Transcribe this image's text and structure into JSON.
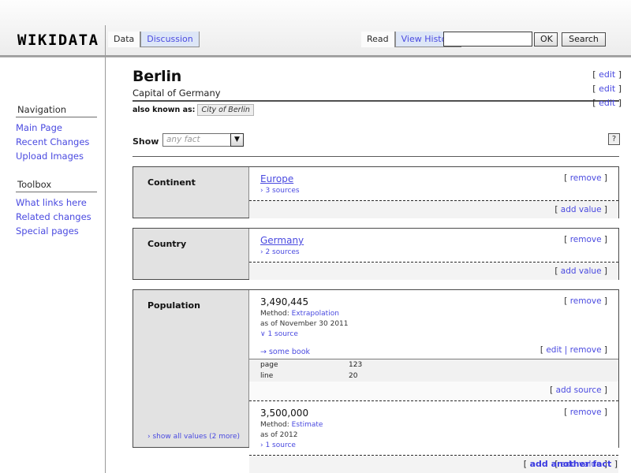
{
  "header": {
    "logo": "WIKIDATA",
    "left_tabs": [
      {
        "label": "Data",
        "active": true
      },
      {
        "label": "Discussion",
        "active": false
      }
    ],
    "right_tabs": [
      {
        "label": "Read",
        "active": true
      },
      {
        "label": "View History",
        "active": false
      }
    ],
    "search": {
      "value": "",
      "placeholder": ""
    },
    "ok_label": "OK",
    "search_label": "Search"
  },
  "sidebar": {
    "navigation_heading": "Navigation",
    "navigation_items": [
      "Main Page",
      "Recent Changes",
      "Upload Images"
    ],
    "toolbox_heading": "Toolbox",
    "toolbox_items": [
      "What links here",
      "Related changes",
      "Special pages"
    ]
  },
  "page": {
    "title": "Berlin",
    "subtitle": "Capital of Germany",
    "aka_label": "also known as:",
    "aka_value": "City of Berlin",
    "edit_label": "[ edit ]",
    "edit_text": "edit"
  },
  "filter": {
    "show_label": "Show",
    "selected": "any fact",
    "help_label": "?"
  },
  "labels": {
    "remove": "remove",
    "add_value": "add value",
    "add_source": "add source",
    "edit": "edit",
    "edit_remove": "edit | remove",
    "add_another_fact": "add another fact"
  },
  "facts": [
    {
      "label": "Continent",
      "values": [
        {
          "main": "Europe",
          "is_link": true,
          "sources_toggle": "› 3 sources",
          "action": "[ remove ]"
        }
      ],
      "add_value": "[ add value ]"
    },
    {
      "label": "Country",
      "values": [
        {
          "main": "Germany",
          "is_link": true,
          "sources_toggle": "› 2 sources",
          "action": "[ remove ]"
        }
      ],
      "add_value": "[ add value ]"
    },
    {
      "label": "Population",
      "show_all": "› show all values (2 more)",
      "values": [
        {
          "main": "3,490,445",
          "is_link": false,
          "method_label": "Method:",
          "method_value": "Extrapolation",
          "as_of": "as of November 30 2011",
          "sources_toggle": "∨ 1 source",
          "action": "[ remove ]",
          "sources": [
            {
              "name": "→ some book",
              "action": "[ edit | remove ]",
              "fields": [
                {
                  "key": "page",
                  "value": "123"
                },
                {
                  "key": "line",
                  "value": "20"
                }
              ]
            }
          ],
          "add_source": "[ add source ]"
        },
        {
          "main": "3,500,000",
          "is_link": false,
          "method_label": "Method:",
          "method_value": "Estimate",
          "as_of": "as of 2012",
          "sources_toggle": "› 1 source",
          "action": "[ remove ]"
        }
      ],
      "add_value": "[ add value ]"
    }
  ],
  "footer": {
    "add_another_fact": "[ add another fact ]"
  }
}
